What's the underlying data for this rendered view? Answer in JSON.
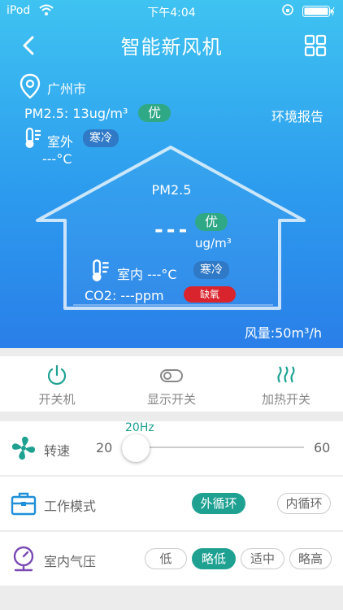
{
  "status_bar": {
    "carrier": "iPod",
    "time": "下午4:04"
  },
  "nav": {
    "title": "智能新风机"
  },
  "outdoor": {
    "city": "广州市",
    "pm25_text": "PM2.5: 13ug/m³",
    "pm25_quality": "优",
    "report_label": "环境报告",
    "label": "室外",
    "temp_badge": "寒冷",
    "temp": "---°C"
  },
  "indoor": {
    "pm25_label": "PM2.5",
    "pm25_value": "---",
    "pm25_quality": "优",
    "pm25_unit": "ug/m³",
    "label": "室内 ---°C",
    "temp_badge": "寒冷",
    "co2_text": "CO2: ---ppm",
    "co2_badge": "缺氧",
    "airflow": "风量:50m³/h"
  },
  "tabs": [
    {
      "label": "开关机",
      "icon": "power-icon"
    },
    {
      "label": "显示开关",
      "icon": "toggle-icon"
    },
    {
      "label": "加热开关",
      "icon": "heat-icon"
    }
  ],
  "speed": {
    "label": "转速",
    "min": "20",
    "max": "60",
    "value": "20Hz"
  },
  "mode": {
    "label": "工作模式",
    "options": [
      "外循环",
      "内循环"
    ],
    "selected": "外循环"
  },
  "pressure": {
    "label": "室内气压",
    "options": [
      "低",
      "略低",
      "适中",
      "略高"
    ],
    "selected": "略低"
  },
  "colors": {
    "accent": "#1fa192",
    "hero_top": "#3fc3f1",
    "hero_bottom": "#2a7fe8",
    "alert": "#d9232d",
    "good": "#2fa886"
  }
}
